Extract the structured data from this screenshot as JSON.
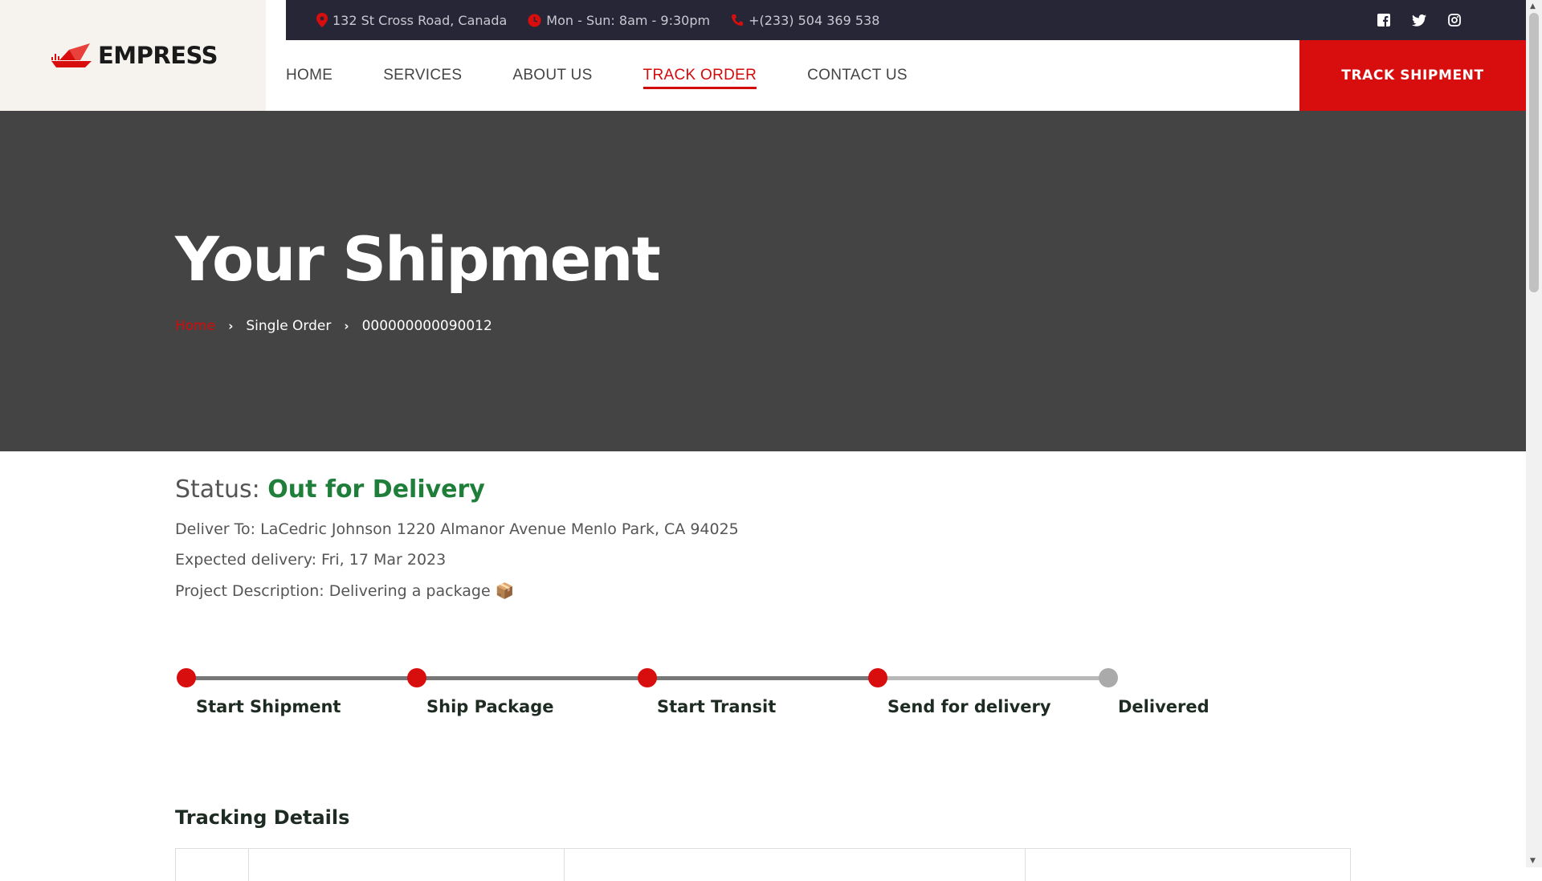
{
  "brand": {
    "name": "EMPRESS",
    "accent": "#d80d0d"
  },
  "topbar": {
    "address": "132 St Cross Road, Canada",
    "hours": "Mon - Sun: 8am - 9:30pm",
    "phone": "+(233) 504 369 538",
    "social_icons": [
      "facebook-icon",
      "twitter-icon",
      "instagram-icon"
    ]
  },
  "nav": {
    "items": [
      {
        "label": "HOME"
      },
      {
        "label": "SERVICES"
      },
      {
        "label": "ABOUT US"
      },
      {
        "label": "TRACK ORDER"
      },
      {
        "label": "CONTACT US"
      }
    ],
    "active": "TRACK ORDER",
    "cta": "TRACK SHIPMENT"
  },
  "hero": {
    "title": "Your Shipment",
    "breadcrumb": [
      "Home",
      "Single Order",
      "000000000090012"
    ]
  },
  "status": {
    "label": "Status: ",
    "value": "Out for Delivery",
    "value_color": "#1f7f3a",
    "deliver_to": "Deliver To: LaCedric Johnson 1220 Almanor Avenue Menlo Park, CA 94025",
    "expected": "Expected delivery: Fri, 17 Mar 2023",
    "description": "Project Description: Delivering a package 📦"
  },
  "progress": {
    "steps": [
      {
        "label": "Start Shipment",
        "done": true
      },
      {
        "label": "Ship Package",
        "done": true
      },
      {
        "label": "Start Transit",
        "done": true
      },
      {
        "label": "Send for delivery",
        "done": true
      },
      {
        "label": "Delivered",
        "done": false
      }
    ],
    "done_color": "#d80d0d",
    "pending_color": "#aaaaaa"
  },
  "tracking": {
    "title": "Tracking Details"
  }
}
